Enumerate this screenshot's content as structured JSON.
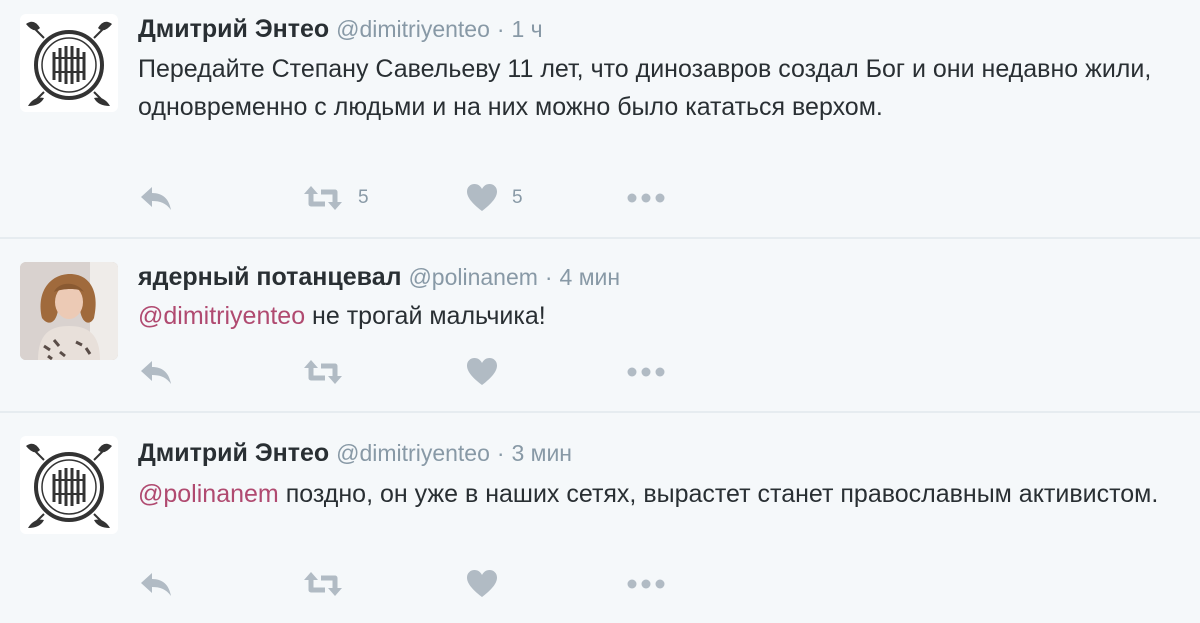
{
  "colors": {
    "background": "#f5f8fa",
    "name": "#292f33",
    "secondary": "#8899a6",
    "mention": "#b04a70",
    "action_icon": "#b1bbc4",
    "divider": "#e6ecf0"
  },
  "tweets": [
    {
      "avatar": "ornamental-logo",
      "name": "Дмитрий Энтео",
      "handle": "@dimitriyenteo",
      "separator": "·",
      "time": "1 ч",
      "mention": "",
      "text": "Передайте Степану Савельеву 11 лет, что динозавров создал Бог и они недавно жили, одновременно с людьми и на них можно было кататься верхом.",
      "retweets": "5",
      "likes": "5"
    },
    {
      "avatar": "user-photo",
      "name": "ядерный потанцевал",
      "handle": "@polinanem",
      "separator": "·",
      "time": "4 мин",
      "mention": "@dimitriyenteo",
      "text": " не трогай мальчика!",
      "retweets": "",
      "likes": ""
    },
    {
      "avatar": "ornamental-logo",
      "name": "Дмитрий Энтео",
      "handle": "@dimitriyenteo",
      "separator": "·",
      "time": "3 мин",
      "mention": "@polinanem",
      "text": " поздно, он уже в наших сетях, вырастет станет православным активистом.",
      "retweets": "",
      "likes": ""
    }
  ],
  "icons": {
    "reply": "reply-icon",
    "retweet": "retweet-icon",
    "like": "heart-icon",
    "more": "more-icon"
  }
}
